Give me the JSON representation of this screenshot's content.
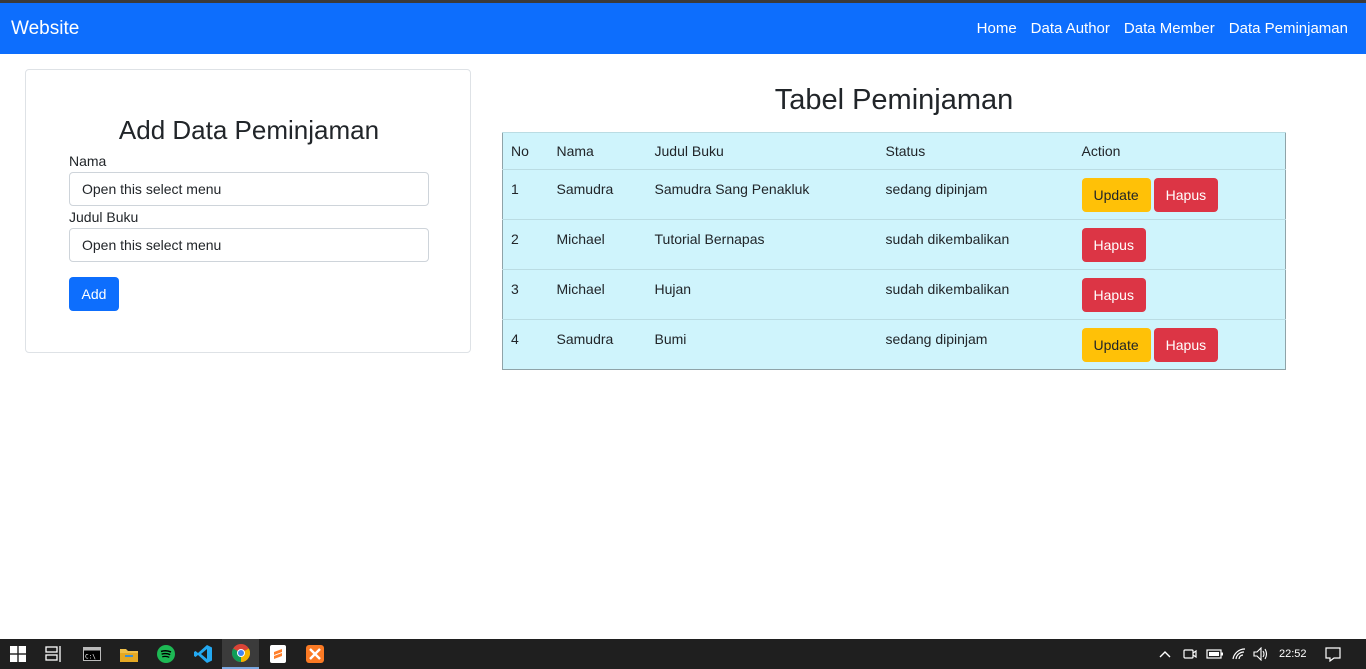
{
  "navbar": {
    "brand": "Website",
    "links": [
      "Home",
      "Data Author",
      "Data Member",
      "Data Peminjaman"
    ]
  },
  "form": {
    "title": "Add Data Peminjaman",
    "nama_label": "Nama",
    "nama_value": "Open this select menu",
    "judul_label": "Judul Buku",
    "judul_value": "Open this select menu",
    "add_label": "Add"
  },
  "table": {
    "title": "Tabel Peminjaman",
    "headers": [
      "No",
      "Nama",
      "Judul Buku",
      "Status",
      "Action"
    ],
    "rows": [
      {
        "no": "1",
        "nama": "Samudra",
        "judul": "Samudra Sang Penakluk",
        "status": "sedang dipinjam",
        "update": "Update",
        "hapus": "Hapus"
      },
      {
        "no": "2",
        "nama": "Michael",
        "judul": "Tutorial Bernapas",
        "status": "sudah dikembalikan",
        "hapus": "Hapus"
      },
      {
        "no": "3",
        "nama": "Michael",
        "judul": "Hujan",
        "status": "sudah dikembalikan",
        "hapus": "Hapus"
      },
      {
        "no": "4",
        "nama": "Samudra",
        "judul": "Bumi",
        "status": "sedang dipinjam",
        "update": "Update",
        "hapus": "Hapus"
      }
    ]
  },
  "taskbar": {
    "icons": [
      "windows-start-icon",
      "task-view-icon",
      "terminal-icon",
      "file-explorer-icon",
      "spotify-icon",
      "vscode-icon",
      "chrome-icon",
      "sublime-icon",
      "xampp-icon"
    ],
    "clock": "22:52"
  },
  "colors": {
    "primary": "#0d6efd",
    "warning": "#ffc107",
    "danger": "#dc3545",
    "table_info": "#cff4fc"
  }
}
